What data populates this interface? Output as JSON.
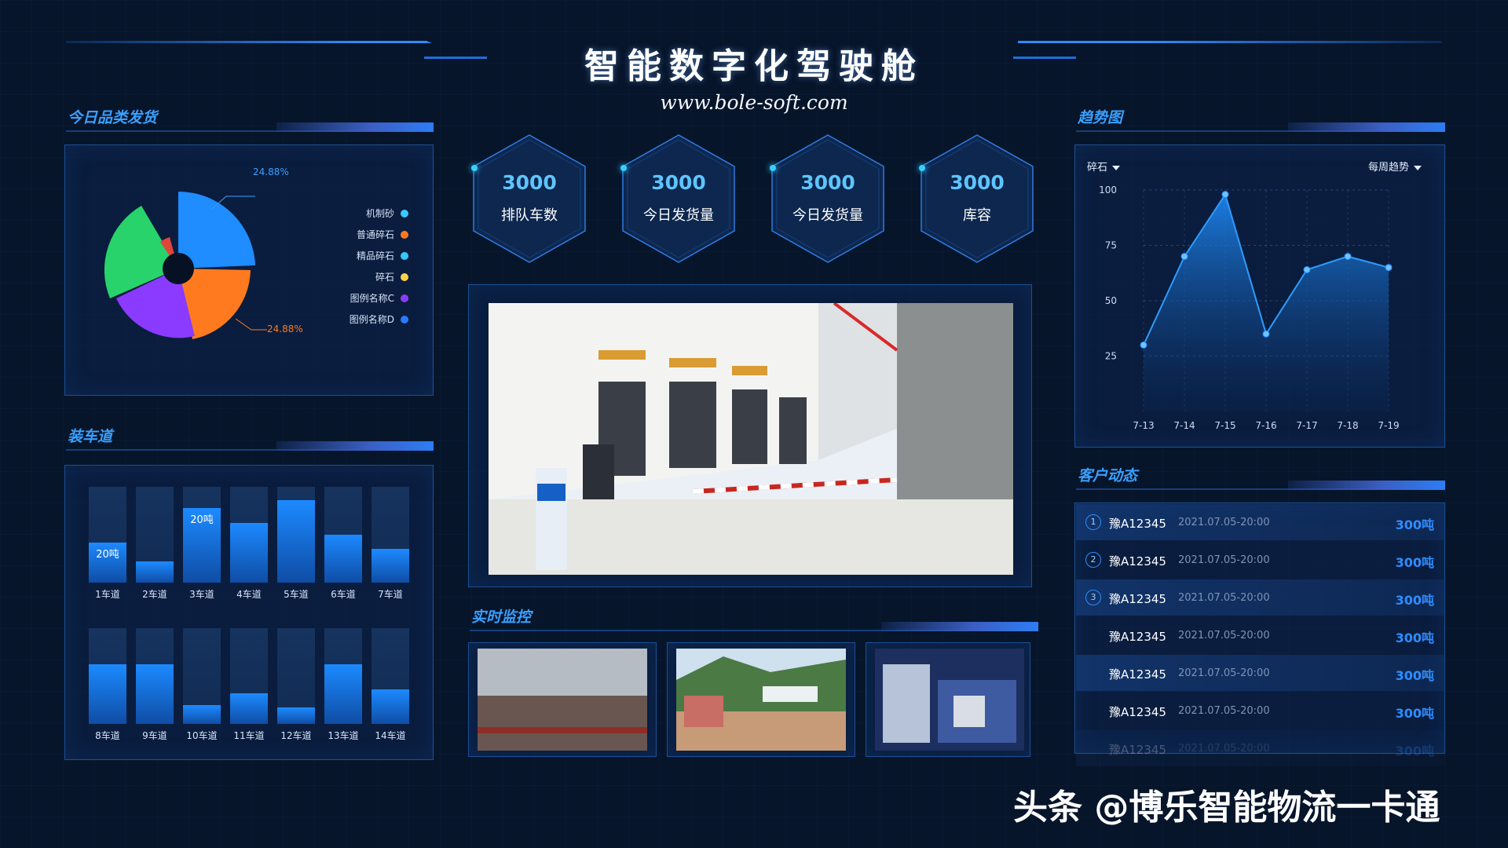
{
  "header": {
    "title": "智能数字化驾驶舱",
    "subtitle": "www.bole-soft.com"
  },
  "category": {
    "title": "今日品类发货",
    "pct_top": "24.88%",
    "pct_bottom": "24.88%",
    "legend": [
      {
        "label": "机制砂",
        "color": "#3bc8ff"
      },
      {
        "label": "普通碎石",
        "color": "#ff7a1f"
      },
      {
        "label": "精品碎石",
        "color": "#36c6ff"
      },
      {
        "label": "碎石",
        "color": "#ffd24a"
      },
      {
        "label": "图例名称C",
        "color": "#8a3bff"
      },
      {
        "label": "图例名称D",
        "color": "#2a7bff"
      }
    ]
  },
  "stats": [
    {
      "value": "3000",
      "label": "排队车数"
    },
    {
      "value": "3000",
      "label": "今日发货量"
    },
    {
      "value": "3000",
      "label": "今日发货量"
    },
    {
      "value": "3000",
      "label": "库容"
    }
  ],
  "lanes": {
    "title": "装车道",
    "row1": [
      {
        "label": "1车道",
        "level": 0.42,
        "cap": "20吨"
      },
      {
        "label": "2车道",
        "level": 0.22,
        "cap": ""
      },
      {
        "label": "3车道",
        "level": 0.78,
        "cap": "20吨"
      },
      {
        "label": "4车道",
        "level": 0.62,
        "cap": ""
      },
      {
        "label": "5车道",
        "level": 0.86,
        "cap": ""
      },
      {
        "label": "6车道",
        "level": 0.5,
        "cap": ""
      },
      {
        "label": "7车道",
        "level": 0.35,
        "cap": ""
      }
    ],
    "row2": [
      {
        "label": "8车道",
        "level": 0.62,
        "cap": ""
      },
      {
        "label": "9车道",
        "level": 0.62,
        "cap": ""
      },
      {
        "label": "10车道",
        "level": 0.2,
        "cap": ""
      },
      {
        "label": "11车道",
        "level": 0.32,
        "cap": ""
      },
      {
        "label": "12车道",
        "level": 0.17,
        "cap": ""
      },
      {
        "label": "13车道",
        "level": 0.62,
        "cap": ""
      },
      {
        "label": "14车道",
        "level": 0.36,
        "cap": ""
      }
    ]
  },
  "monitor": {
    "title": "实时监控"
  },
  "trend": {
    "title": "趋势图",
    "dropdown_left": "碎石",
    "dropdown_right": "每周趋势"
  },
  "chart_data": {
    "type": "area",
    "x": [
      "7-13",
      "7-14",
      "7-15",
      "7-16",
      "7-17",
      "7-18",
      "7-19"
    ],
    "values": [
      30,
      70,
      98,
      35,
      64,
      70,
      65
    ],
    "yticks": [
      25,
      50,
      75,
      100
    ],
    "ylim": [
      0,
      100
    ],
    "grid": true,
    "color": "#1f8fff"
  },
  "customers": {
    "title": "客户动态",
    "rows": [
      {
        "idx": "1",
        "plate": "豫A12345",
        "time": "2021.07.05-20:00",
        "amount": "300吨"
      },
      {
        "idx": "2",
        "plate": "豫A12345",
        "time": "2021.07.05-20:00",
        "amount": "300吨"
      },
      {
        "idx": "3",
        "plate": "豫A12345",
        "time": "2021.07.05-20:00",
        "amount": "300吨"
      },
      {
        "idx": "",
        "plate": "豫A12345",
        "time": "2021.07.05-20:00",
        "amount": "300吨"
      },
      {
        "idx": "",
        "plate": "豫A12345",
        "time": "2021.07.05-20:00",
        "amount": "300吨"
      },
      {
        "idx": "",
        "plate": "豫A12345",
        "time": "2021.07.05-20:00",
        "amount": "300吨"
      },
      {
        "idx": "",
        "plate": "豫A12345",
        "time": "2021.07.05-20:00",
        "amount": "300吨"
      }
    ]
  },
  "footer": {
    "text": "头条 @博乐智能物流一卡通"
  }
}
